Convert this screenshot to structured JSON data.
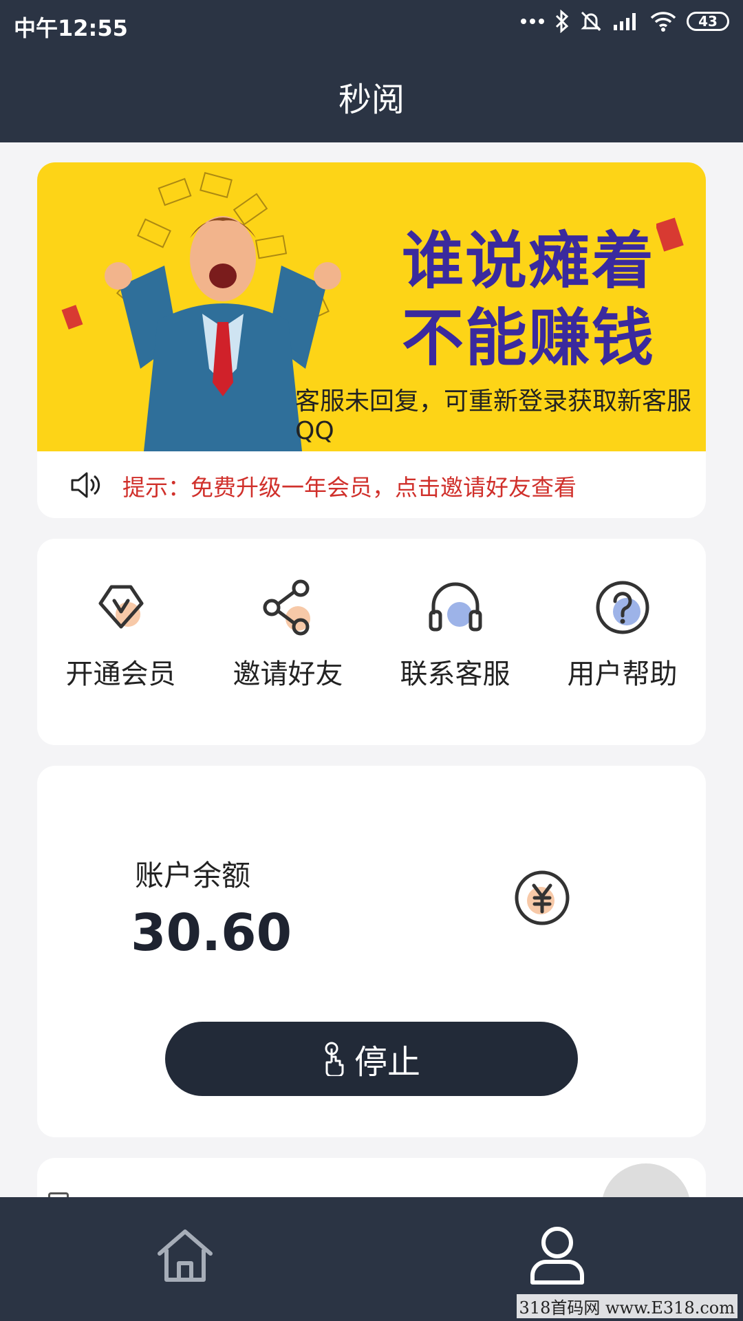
{
  "status_bar": {
    "time": "中午12:55",
    "battery": "43"
  },
  "header": {
    "title": "秒阅"
  },
  "banner": {
    "headline_line1": "谁说瘫着",
    "headline_line2": "不能赚钱",
    "subtitle": "客服未回复，可重新登录获取新客服QQ"
  },
  "notice": {
    "text": "提示：免费升级一年会员，点击邀请好友查看"
  },
  "menu": [
    {
      "label": "开通会员",
      "icon": "vip-icon"
    },
    {
      "label": "邀请好友",
      "icon": "share-icon"
    },
    {
      "label": "联系客服",
      "icon": "headset-icon"
    },
    {
      "label": "用户帮助",
      "icon": "help-icon"
    }
  ],
  "balance": {
    "label": "账户余额",
    "value": "30.60",
    "icon": "yen-icon"
  },
  "action": {
    "stop_label": "停止"
  },
  "nav": [
    {
      "icon": "home-icon"
    },
    {
      "icon": "user-icon"
    }
  ],
  "watermark": "318首码网 www.E318.com",
  "colors": {
    "header_bg": "#2b3444",
    "banner_bg": "#fdd417",
    "headline": "#3a2a9e",
    "notice_text": "#d0302b",
    "button_bg": "#222a38",
    "accent_peach": "#f7c9a8",
    "accent_blue": "#9db3e8"
  }
}
